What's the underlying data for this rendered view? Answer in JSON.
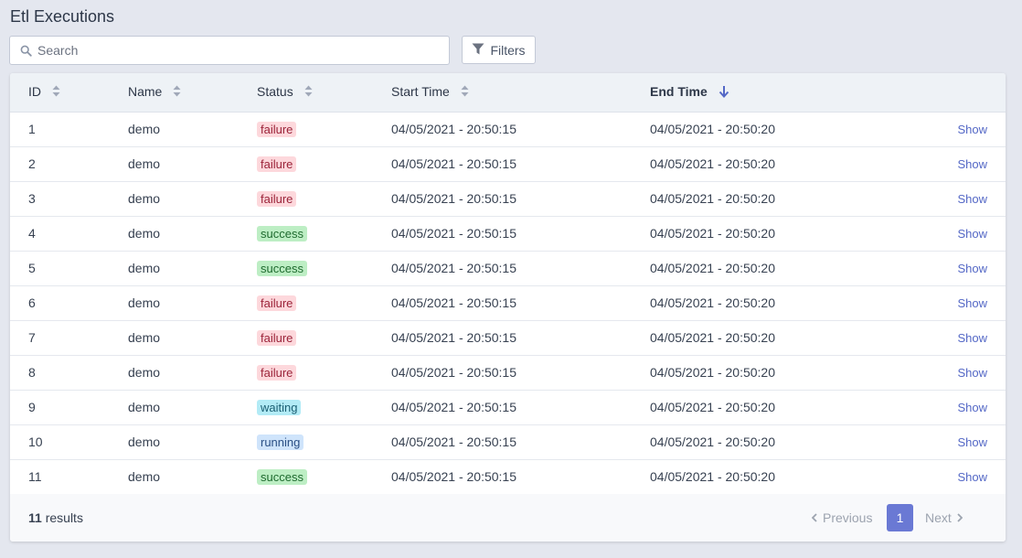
{
  "page": {
    "title": "Etl Executions"
  },
  "search": {
    "placeholder": "Search",
    "value": ""
  },
  "filters": {
    "label": "Filters"
  },
  "table": {
    "columns": {
      "id": "ID",
      "name": "Name",
      "status": "Status",
      "start": "Start Time",
      "end": "End Time"
    },
    "sorted_column": "end",
    "sort_direction": "descending",
    "rows": [
      {
        "id": "1",
        "name": "demo",
        "status": "failure",
        "start": "04/05/2021 - 20:50:15",
        "end": "04/05/2021 - 20:50:20",
        "action": "Show"
      },
      {
        "id": "2",
        "name": "demo",
        "status": "failure",
        "start": "04/05/2021 - 20:50:15",
        "end": "04/05/2021 - 20:50:20",
        "action": "Show"
      },
      {
        "id": "3",
        "name": "demo",
        "status": "failure",
        "start": "04/05/2021 - 20:50:15",
        "end": "04/05/2021 - 20:50:20",
        "action": "Show"
      },
      {
        "id": "4",
        "name": "demo",
        "status": "success",
        "start": "04/05/2021 - 20:50:15",
        "end": "04/05/2021 - 20:50:20",
        "action": "Show"
      },
      {
        "id": "5",
        "name": "demo",
        "status": "success",
        "start": "04/05/2021 - 20:50:15",
        "end": "04/05/2021 - 20:50:20",
        "action": "Show"
      },
      {
        "id": "6",
        "name": "demo",
        "status": "failure",
        "start": "04/05/2021 - 20:50:15",
        "end": "04/05/2021 - 20:50:20",
        "action": "Show"
      },
      {
        "id": "7",
        "name": "demo",
        "status": "failure",
        "start": "04/05/2021 - 20:50:15",
        "end": "04/05/2021 - 20:50:20",
        "action": "Show"
      },
      {
        "id": "8",
        "name": "demo",
        "status": "failure",
        "start": "04/05/2021 - 20:50:15",
        "end": "04/05/2021 - 20:50:20",
        "action": "Show"
      },
      {
        "id": "9",
        "name": "demo",
        "status": "waiting",
        "start": "04/05/2021 - 20:50:15",
        "end": "04/05/2021 - 20:50:20",
        "action": "Show"
      },
      {
        "id": "10",
        "name": "demo",
        "status": "running",
        "start": "04/05/2021 - 20:50:15",
        "end": "04/05/2021 - 20:50:20",
        "action": "Show"
      },
      {
        "id": "11",
        "name": "demo",
        "status": "success",
        "start": "04/05/2021 - 20:50:15",
        "end": "04/05/2021 - 20:50:20",
        "action": "Show"
      }
    ]
  },
  "footer": {
    "count": "11",
    "results_label": "results",
    "previous": "Previous",
    "current_page": "1",
    "next": "Next"
  },
  "colors": {
    "accent": "#6a79d4",
    "link": "#5468c6",
    "failure_bg": "#fdd8dc",
    "success_bg": "#bdeec4",
    "waiting_bg": "#b2ebf6",
    "running_bg": "#cfe4fb"
  },
  "icons": {
    "search": "search-icon",
    "filter": "filter-icon",
    "sort": "sort-icon",
    "sort_desc": "arrow-down-icon",
    "prev": "chevron-left-icon",
    "next": "chevron-right-icon"
  }
}
